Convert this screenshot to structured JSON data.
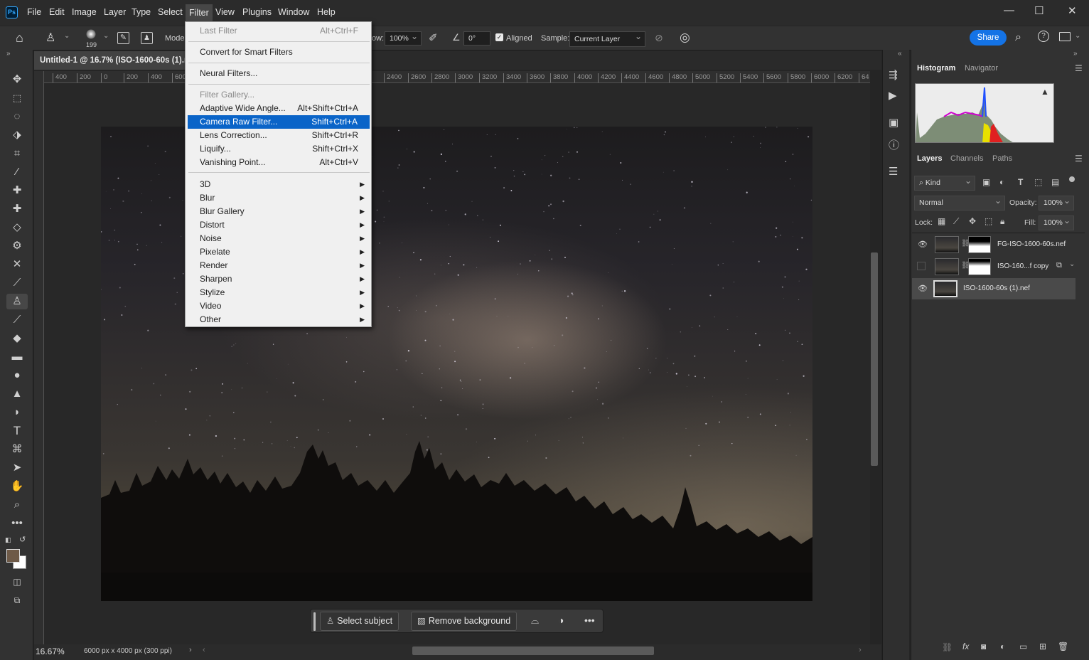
{
  "app": {
    "logo": "Ps"
  },
  "menubar": {
    "items": [
      "File",
      "Edit",
      "Image",
      "Layer",
      "Type",
      "Select",
      "Filter",
      "View",
      "Plugins",
      "Window",
      "Help"
    ],
    "active": "Filter"
  },
  "window_controls": {
    "minimize": "—",
    "maximize": "☐",
    "close": "✕"
  },
  "options_bar": {
    "brush_size": "199",
    "mode_label": "Mode:",
    "flow_label": "ow:",
    "flow_value": "100%",
    "angle_value": "0°",
    "aligned_label": "Aligned",
    "sample_label": "Sample:",
    "sample_value": "Current Layer",
    "share_label": "Share"
  },
  "document": {
    "tab_title": "Untitled-1 @ 16.7% (ISO-1600-60s (1).n",
    "zoom": "16.67%",
    "info": "6000 px x 4000 px (300 ppi)"
  },
  "ruler": {
    "ticks": [
      "400",
      "200",
      "0",
      "200",
      "400",
      "600",
      "2400",
      "2600",
      "2800",
      "3000",
      "3200",
      "3400",
      "3600",
      "3800",
      "4000",
      "4200",
      "4400",
      "4600",
      "4800",
      "5000",
      "5200",
      "5400",
      "5600",
      "5800",
      "6000",
      "6200",
      "64"
    ]
  },
  "context_bar": {
    "select_subject": "Select subject",
    "remove_background": "Remove background"
  },
  "filter_menu": {
    "last_filter": {
      "label": "Last Filter",
      "shortcut": "Alt+Ctrl+F"
    },
    "convert_smart": "Convert for Smart Filters",
    "neural": "Neural Filters...",
    "gallery": "Filter Gallery...",
    "adaptive": {
      "label": "Adaptive Wide Angle...",
      "shortcut": "Alt+Shift+Ctrl+A"
    },
    "camera_raw": {
      "label": "Camera Raw Filter...",
      "shortcut": "Shift+Ctrl+A"
    },
    "lens": {
      "label": "Lens Correction...",
      "shortcut": "Shift+Ctrl+R"
    },
    "liquify": {
      "label": "Liquify...",
      "shortcut": "Shift+Ctrl+X"
    },
    "vanishing": {
      "label": "Vanishing Point...",
      "shortcut": "Alt+Ctrl+V"
    },
    "submenus": [
      "3D",
      "Blur",
      "Blur Gallery",
      "Distort",
      "Noise",
      "Pixelate",
      "Render",
      "Sharpen",
      "Stylize",
      "Video",
      "Other"
    ]
  },
  "panels": {
    "top_tabs": {
      "histogram": "Histogram",
      "navigator": "Navigator"
    },
    "layer_tabs": {
      "layers": "Layers",
      "channels": "Channels",
      "paths": "Paths"
    },
    "kind_label": "Kind",
    "blend_mode": "Normal",
    "opacity_label": "Opacity:",
    "opacity_value": "100%",
    "lock_label": "Lock:",
    "fill_label": "Fill:",
    "fill_value": "100%",
    "layers": [
      {
        "name": "FG-ISO-1600-60s.nef",
        "visible": true
      },
      {
        "name": "ISO-160...f copy",
        "visible": false
      },
      {
        "name": "ISO-1600-60s (1).nef",
        "visible": true,
        "selected": true
      }
    ]
  },
  "colors": {
    "accent": "#1473e6",
    "menu_highlight": "#0a64c8",
    "foreground_swatch": "#6e5a48"
  }
}
